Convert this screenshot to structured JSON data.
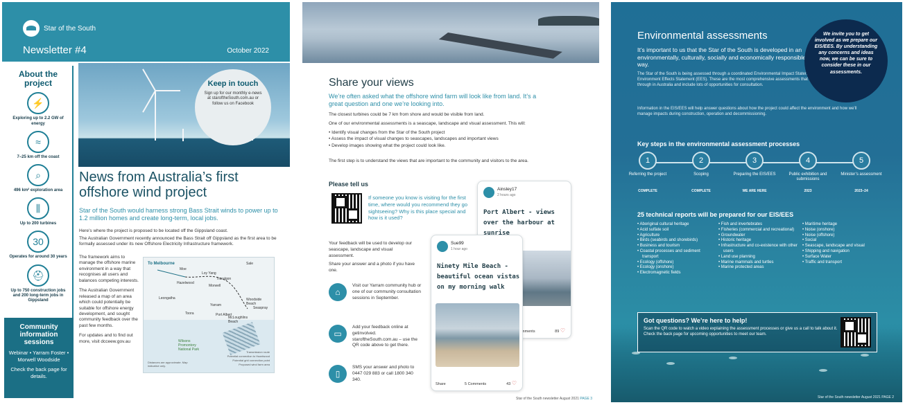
{
  "page1": {
    "brand": "Star of the South",
    "newsletter": "Newsletter #4",
    "date": "October 2022",
    "sidebar_title": "About the project",
    "stats": [
      {
        "icon": "lightning-icon",
        "glyph": "⚡",
        "text": "Exploring up to 2.2 GW of energy"
      },
      {
        "icon": "coast-icon",
        "glyph": "≈",
        "text": "7–25 km off the coast"
      },
      {
        "icon": "magnifier-icon",
        "glyph": "⌕",
        "text": "496 km² exploration area"
      },
      {
        "icon": "turbines-icon",
        "glyph": "⫼",
        "text": "Up to 200 turbines"
      },
      {
        "icon": "thirty-years-icon",
        "glyph": "30",
        "text": "Operates for around 30 years"
      },
      {
        "icon": "hardhat-icon",
        "glyph": "⛑",
        "text": "Up to 750 construction jobs and 200 long-term jobs in Gippsland"
      }
    ],
    "community": {
      "title": "Community information sessions",
      "body": "Webinar • Yarram Foster • Morwell Woodside",
      "cta": "Check the back page for details."
    },
    "keep_in_touch": {
      "title": "Keep in touch",
      "body": "Sign up for our monthly e-news at staroftheSouth.com.au or follow us on Facebook"
    },
    "headline": "News from Australia’s first offshore wind project",
    "subhead": "Star of the South would harness strong Bass Strait winds to power up to 1.2 million homes and create long-term, local jobs.",
    "para1": "Here’s where the project is proposed to be located off the Gippsland coast.",
    "para2": "The Australian Government recently announced the Bass Strait off Gippsland as the first area to be formally assessed under its new Offshore Electricity Infrastructure framework.",
    "col_paras": [
      "The framework aims to manage the offshore marine environment in a way that recognises all users and balances competing interests.",
      "The Australian Government released a map of an area which could potentially be suitable for offshore energy development, and sought community feedback over the past few months.",
      "For updates and to find out more, visit dcceew.gov.au"
    ],
    "map": {
      "to_melbourne": "To Melbourne",
      "places": [
        "Sale",
        "Moe",
        "Traralgon",
        "Loy Yang",
        "Hazelwood",
        "Morwell",
        "Leongatha",
        "Toora",
        "Yarram",
        "Port Albert",
        "McLoughlins Beach",
        "Woodside Beach",
        "Seaspray",
        "Wilsons Promontory National Park"
      ],
      "legend": [
        "Transmission route",
        "Potential connection to Hazelwood",
        "Potential grid connection point",
        "Proposed wind farm area"
      ],
      "note": "Distances are approximate. Map indicative only."
    }
  },
  "page2": {
    "title": "Share your views",
    "lead": "We’re often asked what the offshore wind farm will look like from land. It’s a great question and one we’re looking into.",
    "p1": "The closest turbines could be 7 km from shore and would be visible from land.",
    "p2": "One of our environmental assessments is a seascape, landscape and visual assessment. This will:",
    "bullets": [
      "Identify visual changes from the Star of the South project",
      "Assess the impact of visual changes to seascapes, landscapes and important views",
      "Develop images showing what the project could look like."
    ],
    "p3": "The first step is to understand the views that are important to the community and visitors to the area.",
    "tell_us": "Please tell us",
    "question": "If someone you know is visiting for the first time, where would you recommend they go sightseeing? Why is this place special and how is it used?",
    "feedback": "Your feedback will be used to develop our seascape, landscape and visual assessment.",
    "share": "Share your answer and a photo if you have one.",
    "channels": [
      {
        "icon": "community-hub-icon",
        "glyph": "⌂",
        "text": "Visit our Yarram community hub or one of our community consultation sessions in September."
      },
      {
        "icon": "laptop-icon",
        "glyph": "▭",
        "text": "Add your feedback online at getinvolved. staroftheSouth.com.au – use the QR code above to get there."
      },
      {
        "icon": "phone-icon",
        "glyph": "▯",
        "text": "SMS your answer and photo to 0447 029 883 or call 1800 340 340."
      }
    ],
    "post1": {
      "user": "Ainsley17",
      "time": "2 hours ago",
      "text": "Port Albert - views over the harbour at sunrise",
      "comments": "Comments",
      "likes": "89"
    },
    "post2": {
      "user": "Sue99",
      "time": "1 hour ago",
      "text": "Ninety Mile Beach - beautiful ocean vistas on my morning walk",
      "share": "Share",
      "comments": "5 Comments",
      "likes": "43"
    },
    "footer": "Star of the South newsletter August 2021",
    "page_no": "PAGE 3"
  },
  "page3": {
    "title": "Environmental assessments",
    "lead": "It’s important to us that the Star of the South is developed in an environmentally, culturally, socially and economically responsible way.",
    "p1": "The Star of the South is being assessed through a coordinated Environmental Impact Statement (EIS) and Environment Effects Statement (EES). These are the most comprehensive assessments that a project can go through in Australia and include lots of opportunities for consultation.",
    "p2": "Information in the EIS/EES will help answer questions about how the project could affect the environment and how we’ll manage impacts during construction, operation and decommissioning.",
    "invite": "We invite you to get involved as we prepare our EIS/EES. By understanding any concerns and ideas now, we can be sure to consider these in our assessments.",
    "steps_title": "Key steps in the environmental assessment processes",
    "steps": [
      {
        "num": "1",
        "label": "Referring the project",
        "status": "COMPLETE"
      },
      {
        "num": "2",
        "label": "Scoping",
        "status": "COMPLETE"
      },
      {
        "num": "3",
        "label": "Preparing the EIS/EES",
        "status": "WE ARE HERE"
      },
      {
        "num": "4",
        "label": "Public exhibition and submissions",
        "status": "2023"
      },
      {
        "num": "5",
        "label": "Minister’s assessment",
        "status": "2023–24"
      }
    ],
    "reports_title": "25 technical reports will be prepared for our EIS/EES",
    "reports_col1": [
      "Aboriginal cultural heritage",
      "Acid sulfate soil",
      "Agriculture",
      "Birds (seabirds and shorebirds)",
      "Business and tourism",
      "Coastal processes and sediment transport",
      "Ecology (offshore)",
      "Ecology (onshore)",
      "Electromagnetic fields"
    ],
    "reports_col2": [
      "Fish and invertebrates",
      "Fisheries (commercial and recreational)",
      "Groundwater",
      "Historic heritage",
      "Infrastructure and co-existence with other users",
      "Land use planning",
      "Marine mammals and turtles",
      "Marine protected areas"
    ],
    "reports_col3": [
      "Maritime heritage",
      "Noise (onshore)",
      "Noise (offshore)",
      "Social",
      "Seascape, landscape and visual",
      "Shipping and navigation",
      "Surface Water",
      "Traffic and transport"
    ],
    "questions_title": "Got questions? We’re here to help!",
    "questions_body": "Scan the QR code to watch a video explaining the assessment processes or give us a call to talk about it. Check the back page for upcoming opportunities to meet our team.",
    "footer": "Star of the South newsletter August 2021   PAGE 2"
  }
}
